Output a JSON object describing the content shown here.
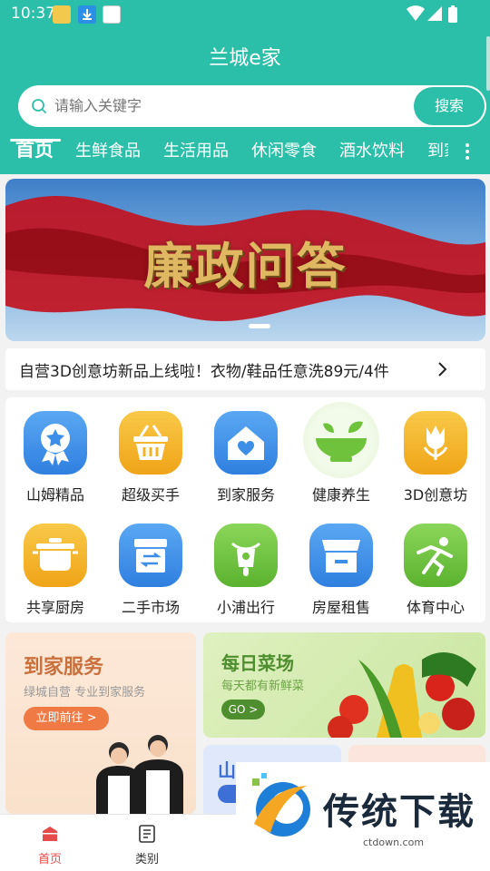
{
  "status_bar": {
    "time": "10:37"
  },
  "header": {
    "title": "兰城e家"
  },
  "search": {
    "placeholder": "请输入关键字",
    "button": "搜索"
  },
  "tabs": [
    "首页",
    "生鲜食品",
    "生活用品",
    "休闲零食",
    "酒水饮料",
    "到家"
  ],
  "banner": {
    "title": "廉政问答"
  },
  "notice": {
    "text": "自营3D创意坊新品上线啦！衣物/鞋品任意洗89元/4件"
  },
  "grid": [
    {
      "label": "山姆精品",
      "icon": "medal-icon",
      "color": "#3d8ee6"
    },
    {
      "label": "超级买手",
      "icon": "basket-icon",
      "color": "#f4b324"
    },
    {
      "label": "到家服务",
      "icon": "house-icon",
      "color": "#3d8ee6"
    },
    {
      "label": "健康养生",
      "icon": "bowl-icon",
      "color": "#6fc23b"
    },
    {
      "label": "3D创意坊",
      "icon": "tulip-icon",
      "color": "#f4b324"
    },
    {
      "label": "共享厨房",
      "icon": "pot-icon",
      "color": "#f4b324"
    },
    {
      "label": "二手市场",
      "icon": "exchange-box-icon",
      "color": "#3d8ee6"
    },
    {
      "label": "小浦出行",
      "icon": "scooter-icon",
      "color": "#6fc23b"
    },
    {
      "label": "房屋租售",
      "icon": "shop-icon",
      "color": "#3d8ee6"
    },
    {
      "label": "体育中心",
      "icon": "runner-icon",
      "color": "#6fc23b"
    }
  ],
  "promo": {
    "left": {
      "title": "到家服务",
      "subtitle": "绿城自营 专业到家服务",
      "button": "立即前往 >"
    },
    "right": {
      "title": "每日菜场",
      "subtitle": "每天都有新鲜菜",
      "button": "GO >"
    },
    "mid1": {
      "title": "山"
    },
    "mid2": {
      "title": ""
    }
  },
  "bottom_nav": [
    {
      "label": "首页",
      "icon": "home-icon",
      "active": true
    },
    {
      "label": "类别",
      "icon": "document-icon",
      "active": false
    }
  ],
  "watermark": {
    "text": "传统下载",
    "url": "ctdown.com"
  },
  "colors": {
    "primary": "#2bbfaa",
    "active_nav": "#e54b4b"
  }
}
